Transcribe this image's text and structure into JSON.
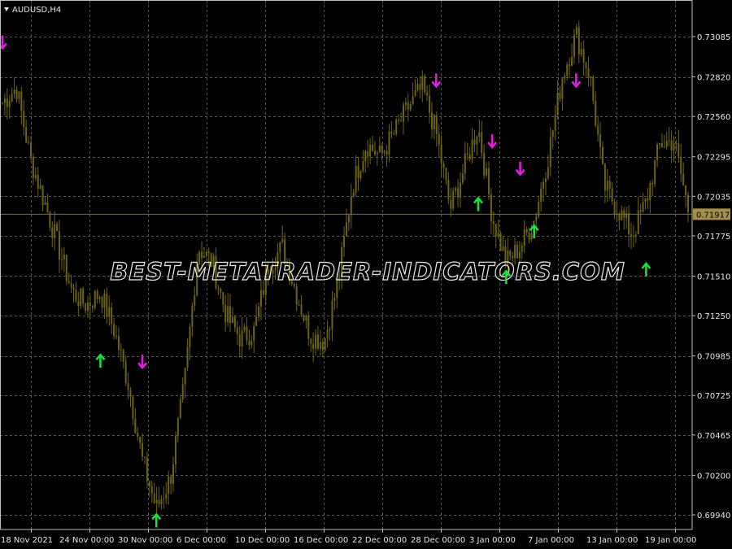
{
  "chart": {
    "symbol_label": "AUDUSD,H4",
    "watermark": "BEST-METATRADER-INDICATORS.COM",
    "current_price": "0.71917",
    "colors": {
      "background": "#000000",
      "candles": "#6b6418",
      "grid": "#585858",
      "axis_text": "#e6e6e6",
      "buy_arrow": "#19e33a",
      "sell_arrow": "#e61ce6",
      "price_tag": "#a58f4e"
    },
    "price_axis": [
      "0.73085",
      "0.72820",
      "0.72560",
      "0.72295",
      "0.72035",
      "0.71775",
      "0.71510",
      "0.71250",
      "0.70985",
      "0.70725",
      "0.70465",
      "0.70200",
      "0.69940"
    ],
    "time_axis": [
      "18 Nov 2021",
      "24 Nov 00:00",
      "30 Nov 00:00",
      "6 Dec 00:00",
      "10 Dec 00:00",
      "16 Dec 00:00",
      "22 Dec 00:00",
      "28 Dec 00:00",
      "3 Jan 00:00",
      "7 Jan 00:00",
      "13 Jan 00:00",
      "19 Jan 00:00"
    ]
  },
  "chart_data": {
    "type": "candlestick",
    "symbol": "AUDUSD",
    "timeframe": "H4",
    "ylim": [
      0.6985,
      0.7325
    ],
    "series_path_points": [
      {
        "x": "18 Nov 2021",
        "y": 0.7265
      },
      {
        "x": "20 Nov",
        "y": 0.7275
      },
      {
        "x": "22 Nov",
        "y": 0.7228
      },
      {
        "x": "24 Nov",
        "y": 0.72
      },
      {
        "x": "26 Nov",
        "y": 0.717
      },
      {
        "x": "28 Nov",
        "y": 0.714
      },
      {
        "x": "30 Nov",
        "y": 0.7132
      },
      {
        "x": "1 Dec",
        "y": 0.714
      },
      {
        "x": "2 Dec",
        "y": 0.7115
      },
      {
        "x": "3 Dec",
        "y": 0.708
      },
      {
        "x": "4 Dec",
        "y": 0.703
      },
      {
        "x": "5 Dec",
        "y": 0.6998
      },
      {
        "x": "6 Dec",
        "y": 0.7018
      },
      {
        "x": "7 Dec",
        "y": 0.708
      },
      {
        "x": "8 Dec",
        "y": 0.717
      },
      {
        "x": "9 Dec",
        "y": 0.716
      },
      {
        "x": "10 Dec",
        "y": 0.7125
      },
      {
        "x": "11 Dec",
        "y": 0.711
      },
      {
        "x": "13 Dec",
        "y": 0.7115
      },
      {
        "x": "14 Dec",
        "y": 0.7158
      },
      {
        "x": "15 Dec",
        "y": 0.717
      },
      {
        "x": "16 Dec",
        "y": 0.714
      },
      {
        "x": "17 Dec",
        "y": 0.7112
      },
      {
        "x": "19 Dec",
        "y": 0.7108
      },
      {
        "x": "21 Dec",
        "y": 0.7148
      },
      {
        "x": "22 Dec",
        "y": 0.721
      },
      {
        "x": "24 Dec",
        "y": 0.7238
      },
      {
        "x": "27 Dec",
        "y": 0.723
      },
      {
        "x": "28 Dec",
        "y": 0.7245
      },
      {
        "x": "30 Dec",
        "y": 0.7262
      },
      {
        "x": "31 Dec",
        "y": 0.7275
      },
      {
        "x": "2 Jan",
        "y": 0.7245
      },
      {
        "x": "3 Jan",
        "y": 0.7195
      },
      {
        "x": "4 Jan",
        "y": 0.7222
      },
      {
        "x": "5 Jan",
        "y": 0.725
      },
      {
        "x": "6 Jan",
        "y": 0.719
      },
      {
        "x": "7 Jan",
        "y": 0.716
      },
      {
        "x": "8 Jan",
        "y": 0.717
      },
      {
        "x": "10 Jan",
        "y": 0.7188
      },
      {
        "x": "11 Jan",
        "y": 0.723
      },
      {
        "x": "12 Jan",
        "y": 0.7282
      },
      {
        "x": "13 Jan",
        "y": 0.731
      },
      {
        "x": "14 Jan",
        "y": 0.7282
      },
      {
        "x": "15 Jan",
        "y": 0.721
      },
      {
        "x": "17 Jan",
        "y": 0.7195
      },
      {
        "x": "18 Jan",
        "y": 0.7178
      },
      {
        "x": "19 Jan",
        "y": 0.72
      },
      {
        "x": "20 Jan",
        "y": 0.7238
      },
      {
        "x": "21 Jan",
        "y": 0.724
      },
      {
        "x": "22 Jan",
        "y": 0.7195
      }
    ],
    "signals": [
      {
        "type": "sell",
        "x": "18 Nov 2021",
        "y": 0.7305
      },
      {
        "type": "buy",
        "x": "1 Dec",
        "y": 0.7095
      },
      {
        "type": "sell",
        "x": "4 Dec",
        "y": 0.7095
      },
      {
        "type": "buy",
        "x": "5 Dec",
        "y": 0.699
      },
      {
        "type": "sell",
        "x": "2 Jan",
        "y": 0.728
      },
      {
        "type": "buy",
        "x": "5 Jan",
        "y": 0.7198
      },
      {
        "type": "sell",
        "x": "6 Jan",
        "y": 0.724
      },
      {
        "type": "buy",
        "x": "7 Jan",
        "y": 0.715
      },
      {
        "type": "sell",
        "x": "8 Jan",
        "y": 0.7222
      },
      {
        "type": "buy",
        "x": "10 Jan",
        "y": 0.718
      },
      {
        "type": "sell",
        "x": "13 Jan",
        "y": 0.728
      },
      {
        "type": "buy",
        "x": "19 Jan",
        "y": 0.7155
      }
    ],
    "grid": true,
    "legend": "none"
  }
}
